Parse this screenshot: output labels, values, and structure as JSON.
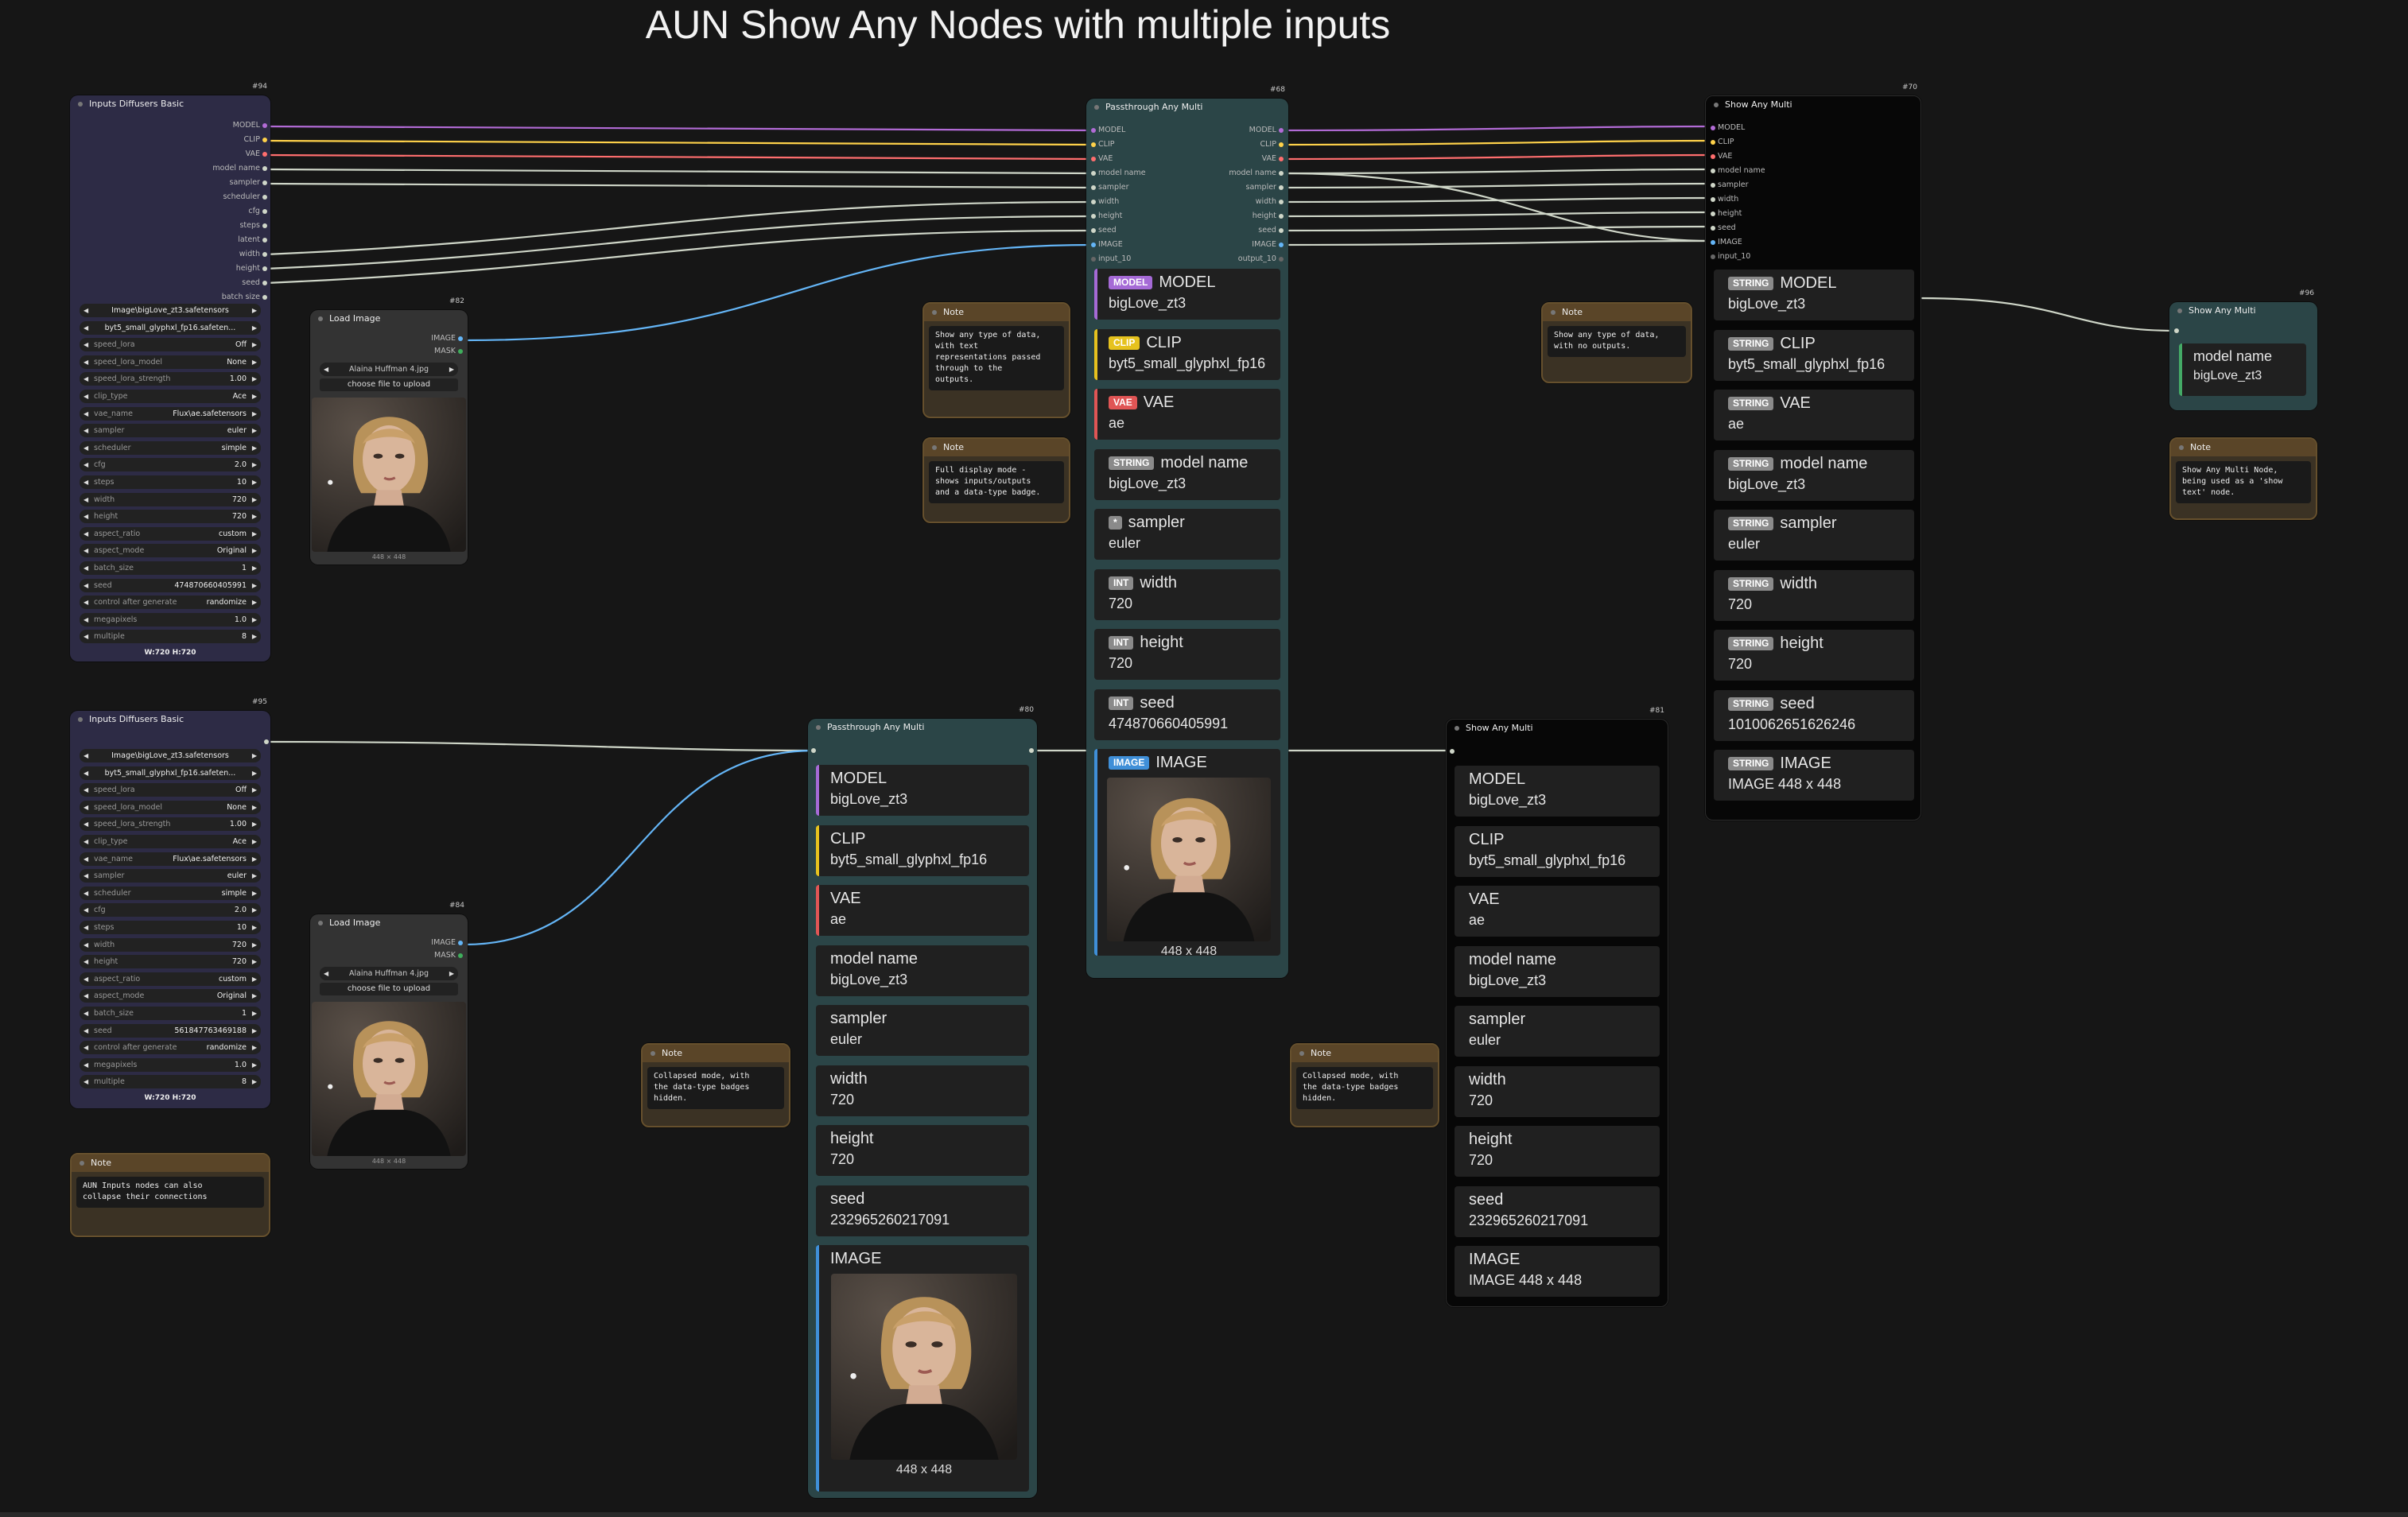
{
  "title": "AUN Show Any Nodes with multiple inputs",
  "colors": {
    "model": "#b26bd6",
    "clip": "#ffd24a",
    "vae": "#ff6e6e",
    "string": "#9aa",
    "int": "#9aa",
    "image": "#64b5f6",
    "link": "#cfd6c8"
  },
  "inputs_top": {
    "id": "#94",
    "title": "Inputs Diffusers Basic",
    "outputs": [
      "MODEL",
      "CLIP",
      "VAE",
      "model name",
      "sampler",
      "scheduler",
      "cfg",
      "steps",
      "latent",
      "width",
      "height",
      "seed",
      "batch size"
    ],
    "widgets": [
      {
        "label": "",
        "value": "Image\\bigLove_zt3.safetensors"
      },
      {
        "label": "",
        "value": "byt5_small_glyphxl_fp16.safeten..."
      },
      {
        "label": "speed_lora",
        "value": "Off"
      },
      {
        "label": "speed_lora_model",
        "value": "None"
      },
      {
        "label": "speed_lora_strength",
        "value": "1.00"
      },
      {
        "label": "clip_type",
        "value": "Ace"
      },
      {
        "label": "vae_name",
        "value": "Flux\\ae.safetensors"
      },
      {
        "label": "sampler",
        "value": "euler"
      },
      {
        "label": "scheduler",
        "value": "simple"
      },
      {
        "label": "cfg",
        "value": "2.0"
      },
      {
        "label": "steps",
        "value": "10"
      },
      {
        "label": "width",
        "value": "720"
      },
      {
        "label": "height",
        "value": "720"
      },
      {
        "label": "aspect_ratio",
        "value": "custom"
      },
      {
        "label": "aspect_mode",
        "value": "Original"
      },
      {
        "label": "batch_size",
        "value": "1"
      },
      {
        "label": "seed",
        "value": "474870660405991"
      },
      {
        "label": "control after generate",
        "value": "randomize"
      },
      {
        "label": "megapixels",
        "value": "1.0"
      },
      {
        "label": "multiple",
        "value": "8"
      }
    ],
    "footer": "W:720 H:720"
  },
  "inputs_bottom": {
    "id": "#95",
    "title": "Inputs Diffusers Basic",
    "widgets": [
      {
        "label": "",
        "value": "Image\\bigLove_zt3.safetensors"
      },
      {
        "label": "",
        "value": "byt5_small_glyphxl_fp16.safeten..."
      },
      {
        "label": "speed_lora",
        "value": "Off"
      },
      {
        "label": "speed_lora_model",
        "value": "None"
      },
      {
        "label": "speed_lora_strength",
        "value": "1.00"
      },
      {
        "label": "clip_type",
        "value": "Ace"
      },
      {
        "label": "vae_name",
        "value": "Flux\\ae.safetensors"
      },
      {
        "label": "sampler",
        "value": "euler"
      },
      {
        "label": "scheduler",
        "value": "simple"
      },
      {
        "label": "cfg",
        "value": "2.0"
      },
      {
        "label": "steps",
        "value": "10"
      },
      {
        "label": "width",
        "value": "720"
      },
      {
        "label": "height",
        "value": "720"
      },
      {
        "label": "aspect_ratio",
        "value": "custom"
      },
      {
        "label": "aspect_mode",
        "value": "Original"
      },
      {
        "label": "batch_size",
        "value": "1"
      },
      {
        "label": "seed",
        "value": "561847763469188"
      },
      {
        "label": "control after generate",
        "value": "randomize"
      },
      {
        "label": "megapixels",
        "value": "1.0"
      },
      {
        "label": "multiple",
        "value": "8"
      }
    ],
    "footer": "W:720 H:720"
  },
  "load_top": {
    "id": "#82",
    "title": "Load Image",
    "outputs": [
      "IMAGE",
      "MASK"
    ],
    "file": "Alaina Huffman 4.jpg",
    "upload": "choose file to upload",
    "dims": "448 × 448"
  },
  "load_bottom": {
    "id": "#84",
    "title": "Load Image",
    "outputs": [
      "IMAGE",
      "MASK"
    ],
    "file": "Alaina Huffman 4.jpg",
    "upload": "choose file to upload",
    "dims": "448 × 448"
  },
  "passthrough_full": {
    "id": "#68",
    "title": "Passthrough Any Multi",
    "inputs": [
      "MODEL",
      "CLIP",
      "VAE",
      "model name",
      "sampler",
      "width",
      "height",
      "seed",
      "IMAGE",
      "input_10"
    ],
    "outputs": [
      "MODEL",
      "CLIP",
      "VAE",
      "model name",
      "sampler",
      "width",
      "height",
      "seed",
      "IMAGE",
      "output_10"
    ],
    "items": [
      {
        "badge": "MODEL",
        "label": "MODEL",
        "value": "bigLove_zt3"
      },
      {
        "badge": "CLIP",
        "label": "CLIP",
        "value": "byt5_small_glyphxl_fp16"
      },
      {
        "badge": "VAE",
        "label": "VAE",
        "value": "ae"
      },
      {
        "badge": "STRING",
        "label": "model name",
        "value": "bigLove_zt3"
      },
      {
        "badge": "*",
        "label": "sampler",
        "value": "euler"
      },
      {
        "badge": "INT",
        "label": "width",
        "value": "720"
      },
      {
        "badge": "INT",
        "label": "height",
        "value": "720"
      },
      {
        "badge": "INT",
        "label": "seed",
        "value": "474870660405991"
      },
      {
        "badge": "IMAGE",
        "label": "IMAGE",
        "value": "448 x 448"
      }
    ]
  },
  "passthrough_collapsed": {
    "id": "#80",
    "title": "Passthrough Any Multi",
    "items": [
      {
        "label": "MODEL",
        "value": "bigLove_zt3"
      },
      {
        "label": "CLIP",
        "value": "byt5_small_glyphxl_fp16"
      },
      {
        "label": "VAE",
        "value": "ae"
      },
      {
        "label": "model name",
        "value": "bigLove_zt3"
      },
      {
        "label": "sampler",
        "value": "euler"
      },
      {
        "label": "width",
        "value": "720"
      },
      {
        "label": "height",
        "value": "720"
      },
      {
        "label": "seed",
        "value": "232965260217091"
      },
      {
        "label": "IMAGE",
        "value": "448 x 448"
      }
    ]
  },
  "show_full": {
    "id": "#70",
    "title": "Show Any Multi",
    "inputs": [
      "MODEL",
      "CLIP",
      "VAE",
      "model name",
      "sampler",
      "width",
      "height",
      "seed",
      "IMAGE",
      "input_10"
    ],
    "items": [
      {
        "badge": "STRING",
        "label": "MODEL",
        "value": "bigLove_zt3"
      },
      {
        "badge": "STRING",
        "label": "CLIP",
        "value": "byt5_small_glyphxl_fp16"
      },
      {
        "badge": "STRING",
        "label": "VAE",
        "value": "ae"
      },
      {
        "badge": "STRING",
        "label": "model name",
        "value": "bigLove_zt3"
      },
      {
        "badge": "STRING",
        "label": "sampler",
        "value": "euler"
      },
      {
        "badge": "STRING",
        "label": "width",
        "value": "720"
      },
      {
        "badge": "STRING",
        "label": "height",
        "value": "720"
      },
      {
        "badge": "STRING",
        "label": "seed",
        "value": "1010062651626246"
      },
      {
        "badge": "STRING",
        "label": "IMAGE",
        "value": "IMAGE 448 x 448"
      }
    ]
  },
  "show_collapsed": {
    "id": "#81",
    "title": "Show Any Multi",
    "items": [
      {
        "label": "MODEL",
        "value": "bigLove_zt3"
      },
      {
        "label": "CLIP",
        "value": "byt5_small_glyphxl_fp16"
      },
      {
        "label": "VAE",
        "value": "ae"
      },
      {
        "label": "model name",
        "value": "bigLove_zt3"
      },
      {
        "label": "sampler",
        "value": "euler"
      },
      {
        "label": "width",
        "value": "720"
      },
      {
        "label": "height",
        "value": "720"
      },
      {
        "label": "seed",
        "value": "232965260217091"
      },
      {
        "label": "IMAGE",
        "value": "IMAGE 448 x 448"
      }
    ]
  },
  "show_small": {
    "id": "#96",
    "title": "Show Any Multi",
    "label": "model name",
    "value": "bigLove_zt3"
  },
  "notes": {
    "n1": {
      "title": "Note",
      "text": "Show any type of data,\nwith text\nrepresentations passed\nthrough to the\noutputs."
    },
    "n2": {
      "title": "Note",
      "text": "Full display mode -\nshows inputs/outputs\nand a data-type badge."
    },
    "n3": {
      "title": "Note",
      "text": "Show any type of data,\nwith no outputs."
    },
    "n4": {
      "title": "Note",
      "text": "Show Any Multi Node,\nbeing used as a 'show\ntext' node."
    },
    "n5": {
      "title": "Note",
      "text": "Collapsed mode, with\nthe data-type badges\nhidden."
    },
    "n6": {
      "title": "Note",
      "text": "Collapsed mode, with\nthe data-type badges\nhidden."
    },
    "n7": {
      "title": "Note",
      "text": "AUN Inputs nodes can also\ncollapse their connections"
    }
  }
}
